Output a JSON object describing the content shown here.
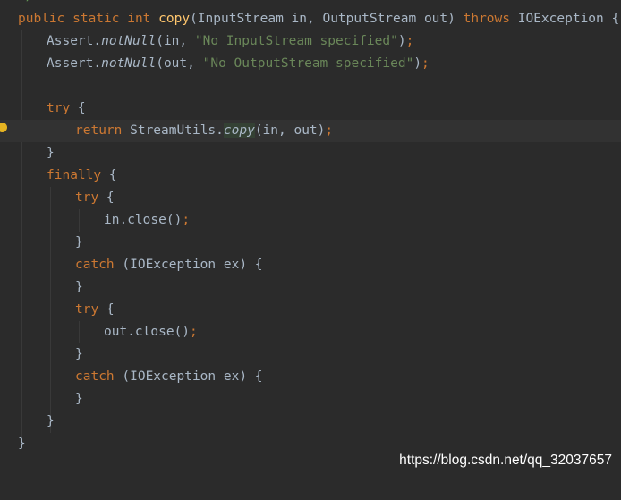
{
  "editor": {
    "top_fragment": "*/",
    "lines": {
      "l1": {
        "kw1": "public static int ",
        "fn": "copy",
        "p1": "(InputStream in, OutputStream out) ",
        "kw2": "throws",
        "p2": " IOException {"
      },
      "l2": {
        "p1": "Assert.",
        "it": "notNull",
        "p2": "(in, ",
        "str": "\"No InputStream specified\"",
        "p3": ")",
        "semi": ";"
      },
      "l3": {
        "p1": "Assert.",
        "it": "notNull",
        "p2": "(out, ",
        "str": "\"No OutputStream specified\"",
        "p3": ")",
        "semi": ";"
      },
      "l5": {
        "kw": "try",
        "p": " {"
      },
      "l6": {
        "kw": "return",
        "p1": " StreamUtils.",
        "it": "copy",
        "p2": "(in, out)",
        "semi": ";"
      },
      "l7": {
        "p": "}"
      },
      "l8": {
        "kw": "finally",
        "p": " {"
      },
      "l9": {
        "kw": "try",
        "p": " {"
      },
      "l10": {
        "p": "in.close()",
        "semi": ";"
      },
      "l11": {
        "p": "}"
      },
      "l12": {
        "kw": "catch",
        "p": " (IOException ex) {"
      },
      "l13": {
        "p": "}"
      },
      "l14": {
        "kw": "try",
        "p": " {"
      },
      "l15": {
        "p": "out.close()",
        "semi": ";"
      },
      "l16": {
        "p": "}"
      },
      "l17": {
        "kw": "catch",
        "p": " (IOException ex) {"
      },
      "l18": {
        "p": "}"
      },
      "l19": {
        "p": "}"
      },
      "l20": {
        "p": "}"
      }
    }
  },
  "watermark": "https://blog.csdn.net/qq_32037657",
  "colors": {
    "background": "#2b2b2b",
    "current_line": "#323232",
    "keyword": "#cc7832",
    "method": "#ffc66d",
    "string": "#6a8759",
    "default_text": "#a9b7c6",
    "intention_bulb": "#e6b422"
  }
}
